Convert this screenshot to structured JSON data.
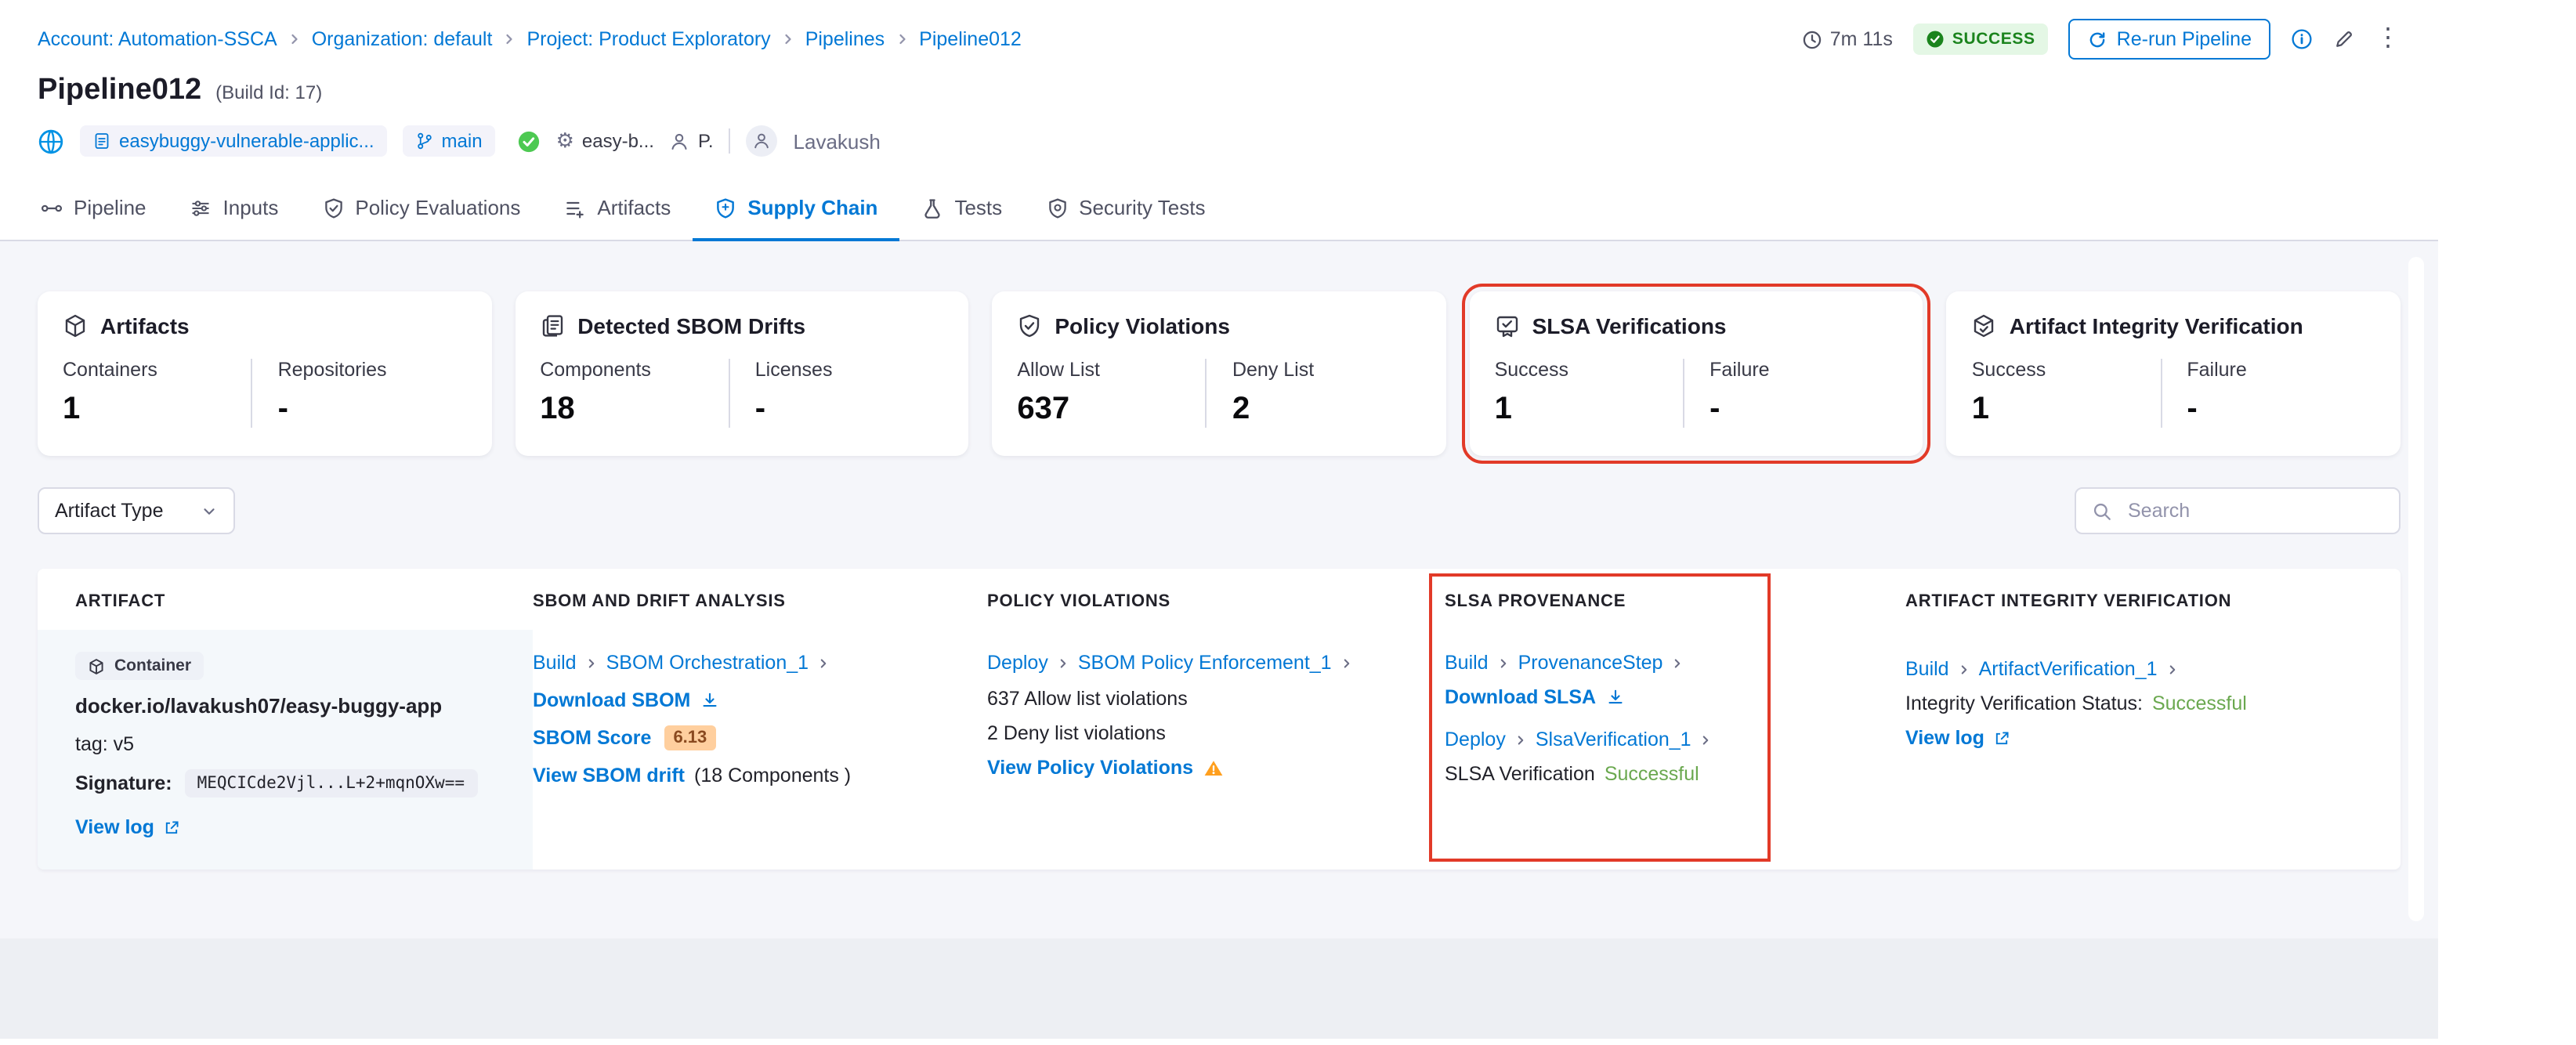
{
  "colors": {
    "accent_blue": "#0278d5",
    "success_badge_bg": "#e4f7e5",
    "success_badge_text": "#1b841d",
    "status_success_green": "#6aa84f",
    "warning_orange": "#ff9f1e",
    "score_badge_bg": "#ffcf9e",
    "score_badge_text": "#8a4a1f",
    "annotation_red": "#e23a28"
  },
  "breadcrumb": {
    "items": [
      "Account: Automation-SSCA",
      "Organization: default",
      "Project: Product Exploratory",
      "Pipelines",
      "Pipeline012"
    ]
  },
  "top_actions": {
    "duration": "7m 11s",
    "status": "SUCCESS",
    "rerun_label": "Re-run Pipeline"
  },
  "header": {
    "title": "Pipeline012",
    "build_id": "(Build Id: 17)"
  },
  "meta": {
    "repo": "easybuggy-vulnerable-applic...",
    "branch": "main",
    "config": "easy-b...",
    "user_initial": "P.",
    "user_name": "Lavakush"
  },
  "tabs": [
    {
      "label": "Pipeline"
    },
    {
      "label": "Inputs"
    },
    {
      "label": "Policy Evaluations"
    },
    {
      "label": "Artifacts"
    },
    {
      "label": "Supply Chain"
    },
    {
      "label": "Tests"
    },
    {
      "label": "Security Tests"
    }
  ],
  "summary_cards": [
    {
      "title": "Artifacts",
      "metrics": [
        {
          "label": "Containers",
          "value": "1"
        },
        {
          "label": "Repositories",
          "value": "-"
        }
      ]
    },
    {
      "title": "Detected SBOM Drifts",
      "metrics": [
        {
          "label": "Components",
          "value": "18"
        },
        {
          "label": "Licenses",
          "value": "-"
        }
      ]
    },
    {
      "title": "Policy Violations",
      "metrics": [
        {
          "label": "Allow List",
          "value": "637"
        },
        {
          "label": "Deny List",
          "value": "2"
        }
      ]
    },
    {
      "title": "SLSA Verifications",
      "metrics": [
        {
          "label": "Success",
          "value": "1"
        },
        {
          "label": "Failure",
          "value": "-"
        }
      ]
    },
    {
      "title": "Artifact Integrity Verification",
      "metrics": [
        {
          "label": "Success",
          "value": "1"
        },
        {
          "label": "Failure",
          "value": "-"
        }
      ]
    }
  ],
  "filters": {
    "artifact_type_label": "Artifact Type",
    "search_placeholder": "Search"
  },
  "table": {
    "columns": [
      "ARTIFACT",
      "SBOM AND DRIFT ANALYSIS",
      "POLICY VIOLATIONS",
      "SLSA PROVENANCE",
      "ARTIFACT INTEGRITY VERIFICATION"
    ],
    "row": {
      "artifact": {
        "type": "Container",
        "name": "docker.io/lavakush07/easy-buggy-app",
        "tag": "tag: v5",
        "signature_label": "Signature:",
        "signature_value": "MEQCICde2Vjl...L+2+mqnOXw==",
        "view_log": "View log"
      },
      "sbom": {
        "stage": "Build",
        "step": "SBOM Orchestration_1",
        "download_label": "Download SBOM",
        "score_label": "SBOM Score",
        "score_value": "6.13",
        "drift_link": "View SBOM drift",
        "drift_note": "(18 Components )"
      },
      "policy": {
        "stage": "Deploy",
        "step": "SBOM Policy Enforcement_1",
        "allow_text": "637 Allow list violations",
        "deny_text": "2 Deny list violations",
        "view_link": "View Policy Violations"
      },
      "slsa": {
        "stage1": "Build",
        "step1": "ProvenanceStep",
        "download_label": "Download SLSA",
        "stage2": "Deploy",
        "step2": "SlsaVerification_1",
        "status_label": "SLSA Verification",
        "status_value": "Successful"
      },
      "integrity": {
        "stage": "Build",
        "step": "ArtifactVerification_1",
        "status_label": "Integrity Verification Status:",
        "status_value": "Successful",
        "view_log": "View log"
      }
    }
  }
}
